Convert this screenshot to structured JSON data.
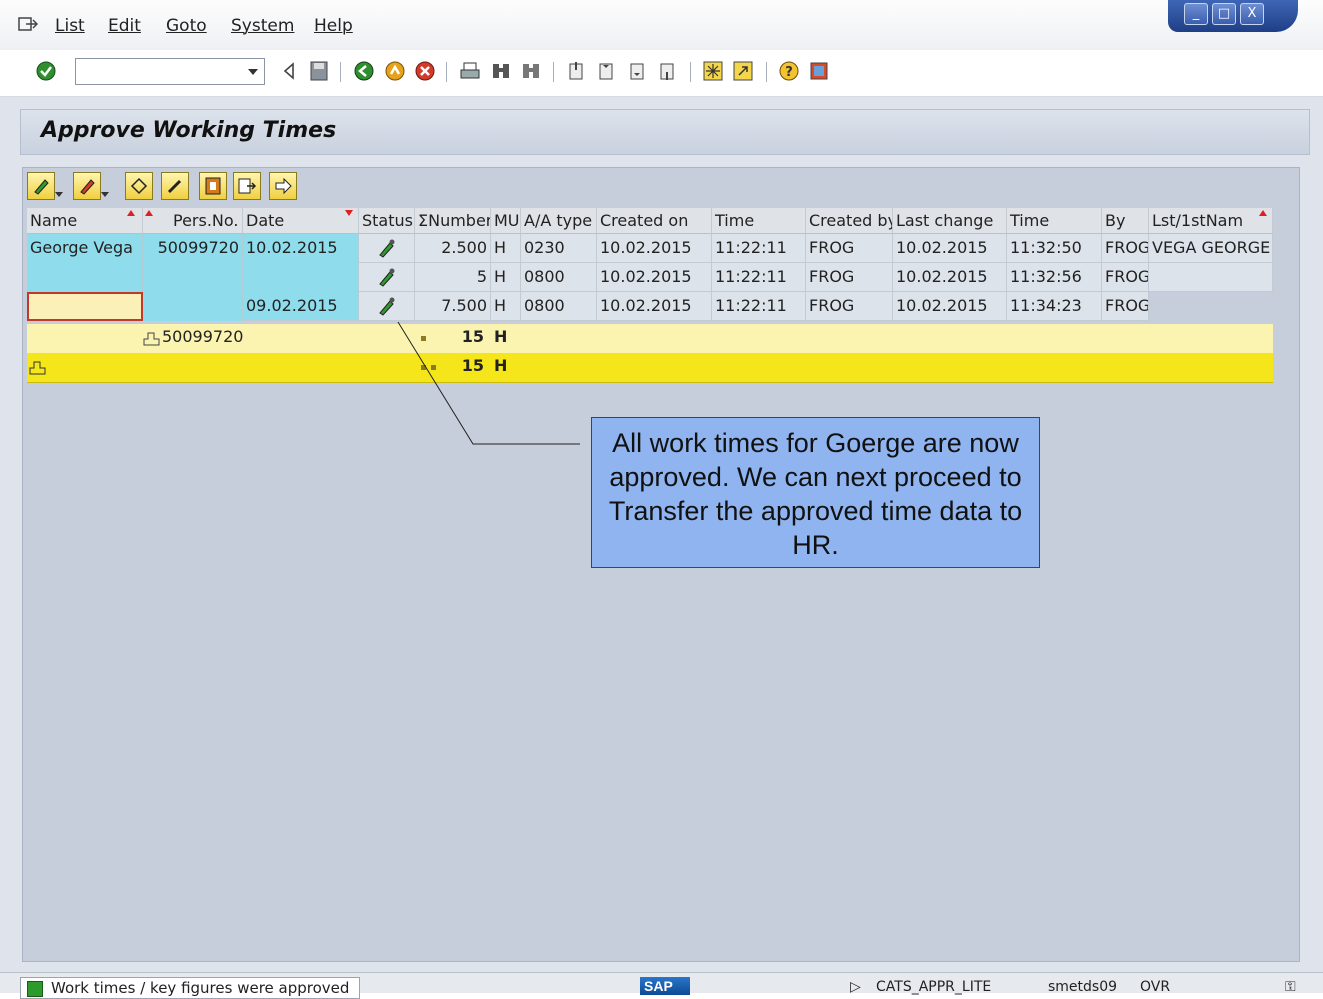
{
  "menu": {
    "items": [
      "List",
      "Edit",
      "Goto",
      "System",
      "Help"
    ]
  },
  "window_controls": [
    "_",
    "□",
    "X"
  ],
  "toolbar": {
    "command_value": "",
    "icons": [
      "enter-icon",
      "back-triangle-icon",
      "save-icon",
      "back-icon",
      "exit-icon",
      "cancel-icon",
      "print-icon",
      "find-icon",
      "find-next-icon",
      "first-page-icon",
      "previous-page-icon",
      "next-page-icon",
      "last-page-icon",
      "create-session-icon",
      "shortcut-icon",
      "help-icon",
      "layout-icon"
    ]
  },
  "page": {
    "title": "Approve Working Times"
  },
  "alv_toolbar": {
    "buttons": [
      "approve-icon",
      "reject-icon",
      "undo-icon",
      "edit-icon",
      "details-icon",
      "export-icon",
      "next-icon"
    ]
  },
  "table": {
    "headers": [
      "Name",
      "Pers.No.",
      "Date",
      "Status",
      "ΣNumber",
      "MU",
      "A/A type",
      "Created on",
      "Time",
      "Created by",
      "Last change",
      "Time",
      "By",
      "Lst/1stNam"
    ],
    "rows": [
      {
        "name": "George Vega",
        "persno": "50099720",
        "date": "10.02.2015",
        "number": "2.500",
        "mu": "H",
        "aatype": "0230",
        "created_on": "10.02.2015",
        "time": "11:22:11",
        "created_by": "FROG",
        "last_change": "10.02.2015",
        "time2": "11:32:50",
        "by": "FROG",
        "lastfirst": "VEGA GEORGE"
      },
      {
        "name": "",
        "persno": "",
        "date": "",
        "number": "5",
        "mu": "H",
        "aatype": "0800",
        "created_on": "10.02.2015",
        "time": "11:22:11",
        "created_by": "FROG",
        "last_change": "10.02.2015",
        "time2": "11:32:56",
        "by": "FROG",
        "lastfirst": ""
      },
      {
        "name": "",
        "persno": "",
        "date": "09.02.2015",
        "number": "7.500",
        "mu": "H",
        "aatype": "0800",
        "created_on": "10.02.2015",
        "time": "11:22:11",
        "created_by": "FROG",
        "last_change": "10.02.2015",
        "time2": "11:34:23",
        "by": "FROG",
        "lastfirst": ""
      }
    ],
    "subtotal": {
      "persno": "50099720",
      "number": "15",
      "mu": "H"
    },
    "total": {
      "number": "15",
      "mu": "H"
    }
  },
  "callout": {
    "text": "All work times for Goerge are now approved. We can next proceed to Transfer the approved time data to HR."
  },
  "statusbar": {
    "message": "Work times / key figures were approved",
    "logo": "SAP",
    "transaction": "CATS_APPR_LITE",
    "server": "smetds09",
    "client": "OVR"
  },
  "colors": {
    "key_column": "#8fdcec",
    "subtotal": "#fbf3b0",
    "total": "#f4e61a",
    "callout": "#8fb4f0"
  }
}
